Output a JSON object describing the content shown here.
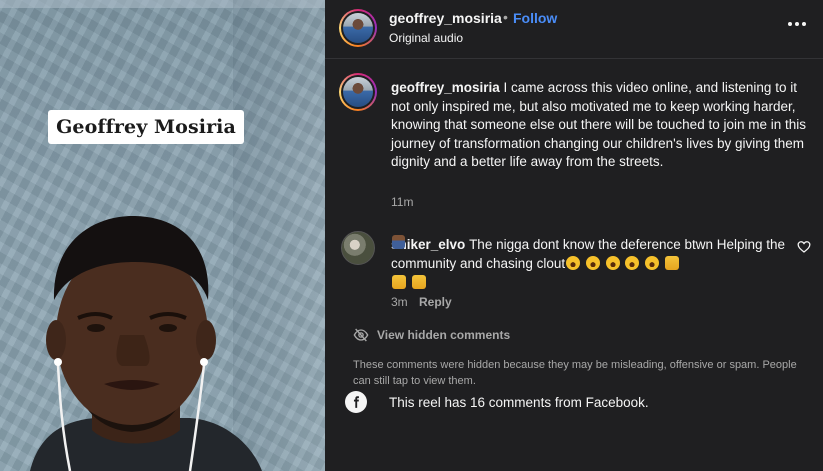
{
  "video": {
    "name_tag": "Geoffrey Mosiria"
  },
  "header": {
    "username": "geoffrey_mosiria",
    "separator": "•",
    "follow_label": "Follow",
    "subtitle": "Original audio",
    "more_icon": "more-horizontal-icon"
  },
  "caption": {
    "username": "geoffrey_mosiria",
    "text": " I came across this video online, and listening to it not only inspired me, but also motivated me to keep working harder, knowing that someone else out there will be touched to join me in this journey of transformation changing our children's lives by giving them dignity and a better life away from the streets.",
    "time": "11m"
  },
  "comments": [
    {
      "username": "sniker_elvo",
      "text_a": " The nigga dont know the deference btwn Helping the community and chasing clout",
      "time": "3m",
      "reply_label": "Reply",
      "like_icon": "heart-icon"
    }
  ],
  "hidden_comments": {
    "label": "View hidden comments",
    "icon": "eye-off-icon",
    "note": "These comments were hidden because they may be misleading, offensive or spam. People can still tap to view them."
  },
  "facebook": {
    "icon": "facebook-icon",
    "text": "This reel has 16 comments from Facebook."
  },
  "colors": {
    "background": "#1f1f21",
    "link": "#4a8df8",
    "secondary_text": "#a8a8a8"
  }
}
